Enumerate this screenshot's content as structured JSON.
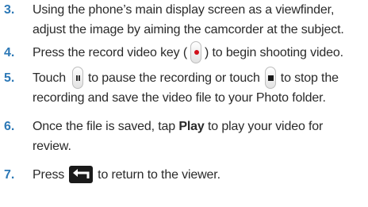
{
  "steps": [
    {
      "number": "3.",
      "lines": [
        "Using the phone’s main display screen as a viewfinder,",
        "adjust the image by aiming the camcorder at the subject."
      ]
    },
    {
      "number": "4.",
      "text_before": "Press the record video key (",
      "text_after": ") to begin shooting video."
    },
    {
      "number": "5.",
      "line1_a": "Touch",
      "line1_b": "to pause the recording or touch",
      "line1_c": "to stop the",
      "line2": "recording and save the video file to your Photo folder."
    },
    {
      "number": "6.",
      "line1_a": "Once the file is saved, tap",
      "line1_bold": "Play",
      "line1_b": "to play your video for",
      "line2": "review."
    },
    {
      "number": "7.",
      "text_before": "Press",
      "text_after": "to return to the viewer."
    }
  ],
  "icons": {
    "record": "record-key-icon",
    "pause": "pause-icon",
    "stop": "stop-icon",
    "back": "back-arrow-icon"
  }
}
